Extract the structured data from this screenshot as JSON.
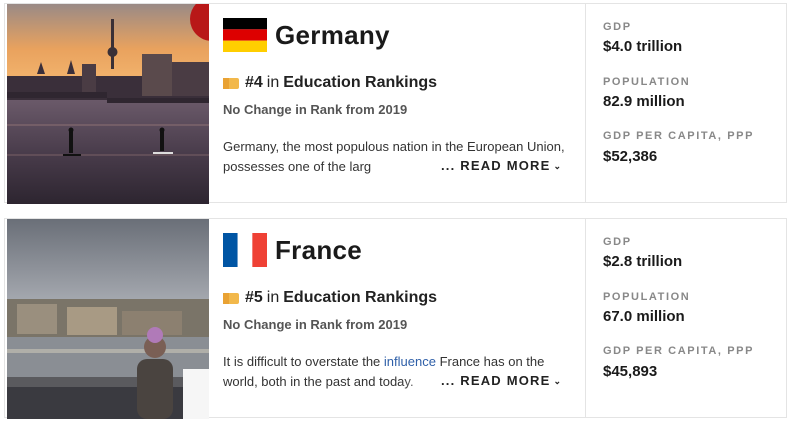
{
  "cards": [
    {
      "country": "Germany",
      "rank_number": "#4",
      "rank_in": "in",
      "rank_category": "Education Rankings",
      "rank_change": "No Change in Rank from 2019",
      "description_text": "Germany, the most populous nation in the European Union, possesses one of the larg",
      "description_link": "",
      "description_tail": "",
      "read_more": "... READ MORE",
      "stats": [
        {
          "label": "GDP",
          "value": "$4.0 trillion"
        },
        {
          "label": "POPULATION",
          "value": "82.9 million"
        },
        {
          "label": "GDP PER CAPITA, PPP",
          "value": "$52,386"
        }
      ],
      "flag_colors": [
        "#000000",
        "#dd0000",
        "#ffce00"
      ]
    },
    {
      "country": "France",
      "rank_number": "#5",
      "rank_in": "in",
      "rank_category": "Education Rankings",
      "rank_change": "No Change in Rank from 2019",
      "description_text": "It is difficult to overstate the ",
      "description_link": "influence",
      "description_tail": " France has on the world, both in the past and today.",
      "read_more": "... READ MORE",
      "stats": [
        {
          "label": "GDP",
          "value": "$2.8 trillion"
        },
        {
          "label": "POPULATION",
          "value": "67.0 million"
        },
        {
          "label": "GDP PER CAPITA, PPP",
          "value": "$45,893"
        }
      ],
      "flag_colors": [
        "#0055a4",
        "#ffffff",
        "#ef4135"
      ]
    }
  ],
  "colors": {
    "badge": "#f2b84b",
    "link": "#2e5fa8",
    "label_gray": "#888888"
  }
}
